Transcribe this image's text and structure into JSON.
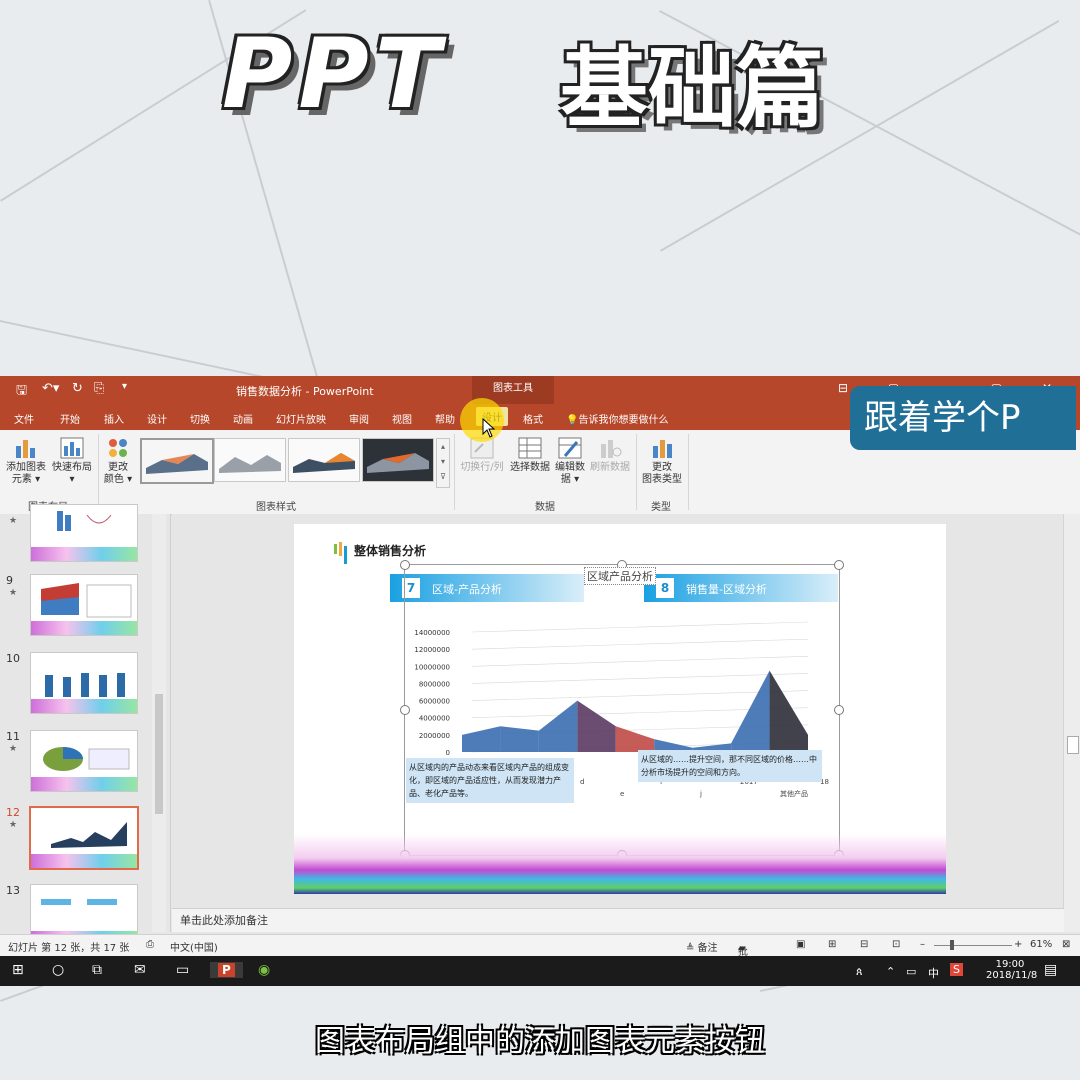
{
  "banner": {
    "latin": "PPT",
    "cjk": "基础篇"
  },
  "window": {
    "doc_title": "销售数据分析  -  PowerPoint",
    "tools_label": "图表工具",
    "ctrls": "⊟ ▢ —  ▢  ✕"
  },
  "tabs": [
    "文件",
    "开始",
    "插入",
    "设计",
    "切换",
    "动画",
    "幻灯片放映",
    "审阅",
    "视图",
    "帮助",
    "设计",
    "格式"
  ],
  "tell_me": "告诉我你想要做什么",
  "ribbon": {
    "add_element": [
      "添加图表",
      "元素 ▾"
    ],
    "quick_layout": [
      "快速布局",
      "▾"
    ],
    "change_color": [
      "更改",
      "颜色 ▾"
    ],
    "group_layout": "图表布局",
    "group_styles": "图表样式",
    "switch_rowcol": "切换行/列",
    "select_data": "选择数据",
    "edit_data": [
      "编辑数",
      "据 ▾"
    ],
    "refresh_data": "刷新数据",
    "group_data": "数据",
    "change_type": [
      "更改",
      "图表类型"
    ],
    "group_type": "类型"
  },
  "badge": "跟着学个P",
  "thumbs": [
    {
      "num": "9",
      "star": "★"
    },
    {
      "num": "10",
      "star": ""
    },
    {
      "num": "11",
      "star": "★"
    },
    {
      "num": "12",
      "star": "★"
    },
    {
      "num": "13",
      "star": ""
    }
  ],
  "slide": {
    "title": "整体销售分析",
    "hdr1_num": "7",
    "hdr1_txt": "区域-产品分析",
    "hdr2_num": "8",
    "hdr2_txt": "销售量-区域分析",
    "chart_title": "区域产品分析",
    "text_left": "从区域内的产品动态来看区域内产品的组成变化，即区域的产品适应性，从而发现潜力产品、老化产品等。",
    "text_right": "从区域的……提升空间，那不同区域的价格……中分析市场提升的空间和方向。"
  },
  "chart_data": {
    "type": "area",
    "title": "区域产品分析",
    "y_ticks": [
      "14000000",
      "12000000",
      "10000000",
      "8000000",
      "6000000",
      "4000000",
      "2000000",
      "0"
    ],
    "x_ticks": [
      "d",
      "e",
      "f",
      "j",
      "2017",
      "其他产品",
      "18"
    ],
    "ylim": [
      0,
      14000000
    ],
    "note": "3D area chart; values estimated",
    "series": [
      {
        "name": "",
        "values": [
          2000000,
          3000000,
          2500000,
          6000000,
          3000000,
          1500000,
          500000,
          1000000,
          9500000,
          2000000
        ]
      }
    ]
  },
  "notes": "单击此处添加备注",
  "status": {
    "slide": "幻灯片 第 12 张，共 17 张",
    "lang": "中文(中国)",
    "notes_btn": "≜ 备注",
    "comments_btn": "批注",
    "zoom": "61%"
  },
  "taskbar": {
    "time": "19:00",
    "date": "2018/11/8",
    "ime": "中"
  },
  "subtitle": "图表布局组中的添加图表元素按钮"
}
